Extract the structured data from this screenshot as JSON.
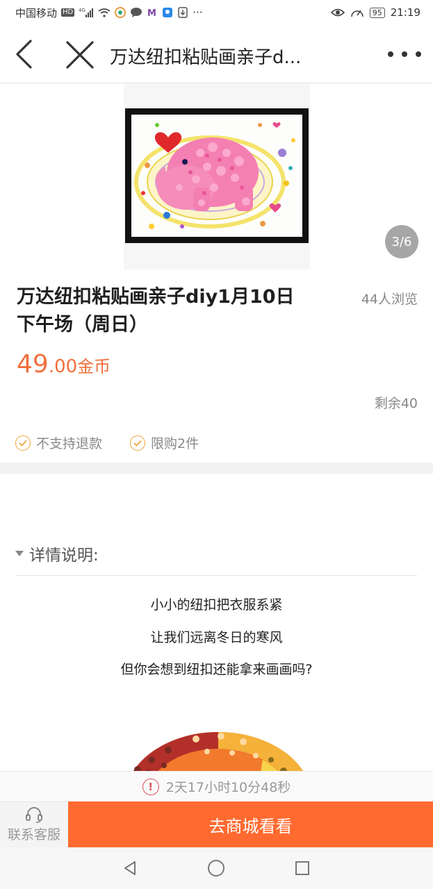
{
  "status_bar": {
    "carrier": "中国移动",
    "hd": "HD",
    "network": "4G",
    "battery": "95",
    "time": "21:19",
    "more": "···"
  },
  "nav": {
    "title": "万达纽扣粘贴画亲子d..."
  },
  "gallery": {
    "pager": "3/6"
  },
  "product": {
    "title": "万达纽扣粘贴画亲子diy1月10日下午场（周日）",
    "views": "44人浏览",
    "price_int": "49",
    "price_dec": ".00",
    "price_unit": "金币",
    "stock": "剩余40",
    "tags": [
      "不支持退款",
      "限购2件"
    ]
  },
  "details": {
    "heading": "详情说明:",
    "lines": [
      "小小的纽扣把衣服系紧",
      "让我们远离冬日的寒风",
      "但你会想到纽扣还能拿来画画吗?"
    ]
  },
  "countdown": {
    "text": "2天17小时10分48秒"
  },
  "actions": {
    "service_label": "联系客服",
    "shop_label": "去商城看看"
  },
  "colors": {
    "accent": "#ff6a30",
    "price": "#f26f3b",
    "tag_check": "#f0a23c",
    "warning": "#e0505a"
  },
  "icons": {
    "back": "chevron-left-icon",
    "close": "close-icon",
    "more": "more-dots-icon",
    "check": "check-circle-icon",
    "warn": "exclamation-circle-icon",
    "service": "headset-icon",
    "sys_back": "triangle-back-icon",
    "sys_home": "circle-home-icon",
    "sys_recent": "square-recent-icon"
  }
}
